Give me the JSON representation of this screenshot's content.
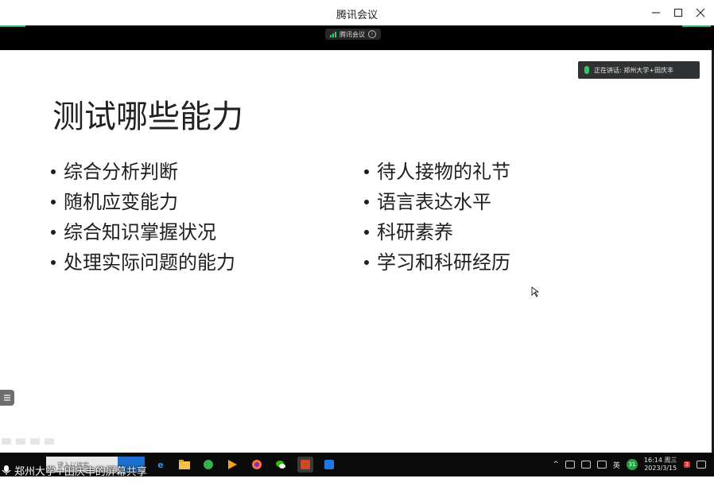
{
  "window": {
    "title": "腾讯会议"
  },
  "meeting_bar": {
    "label": "腾讯会议",
    "accent_color": "#31b16a"
  },
  "speaking": {
    "text": "正在讲话: 郑州大学+田庆丰"
  },
  "slide": {
    "title": "测试哪些能力",
    "left_bullets": [
      "综合分析判断",
      "随机应变能力",
      "综合知识掌握状况",
      "处理实际问题的能力"
    ],
    "right_bullets": [
      "待人接物的礼节",
      "语言表达水平",
      "科研素养",
      "学习和科研经历"
    ]
  },
  "taskbar": {
    "search_placeholder": "键入以搜索",
    "ime": "英",
    "notification_count": "31",
    "action_badge": "3",
    "time": "16:14 周三",
    "date": "2023/3/15"
  },
  "share": {
    "caption": "郑州大学+田庆丰的屏幕共享"
  },
  "colors": {
    "taskbar_bg": "#0b0b0b",
    "meeting_bar_bg": "#000000",
    "search_button": "#1a6fd1"
  }
}
